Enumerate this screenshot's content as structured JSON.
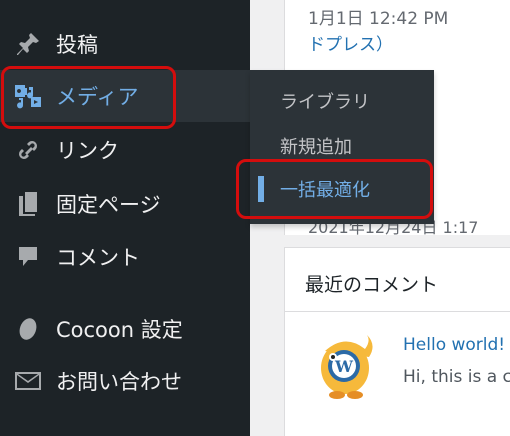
{
  "sidebar": {
    "items": [
      {
        "label": "投稿",
        "icon": "pushpin-icon"
      },
      {
        "label": "メディア",
        "icon": "media-icon"
      },
      {
        "label": "リンク",
        "icon": "link-icon"
      },
      {
        "label": "固定ページ",
        "icon": "pages-icon"
      },
      {
        "label": "コメント",
        "icon": "comment-bubble-icon"
      },
      {
        "label": "Cocoon 設定",
        "icon": "cocoon-icon"
      },
      {
        "label": "お問い合わせ",
        "icon": "envelope-icon"
      }
    ],
    "active_item": "メディア"
  },
  "flyout": {
    "items": [
      {
        "label": "ライブラリ"
      },
      {
        "label": "新規追加"
      },
      {
        "label": "一括最適化"
      }
    ],
    "current": "一括最適化"
  },
  "main": {
    "activity": {
      "date": "1月1日 12:42 PM",
      "link": "ドプレス）",
      "partial_date": "2021年12月24日 1:17"
    },
    "recent_comments": {
      "title": "最近のコメント",
      "author": "Hello world!",
      "excerpt": "Hi, this is a c"
    }
  },
  "colors": {
    "sidebar_bg": "#1d2327",
    "flyout_bg": "#2c3338",
    "accent": "#72aee6",
    "link": "#2271b1",
    "highlight": "#d40d0d"
  }
}
